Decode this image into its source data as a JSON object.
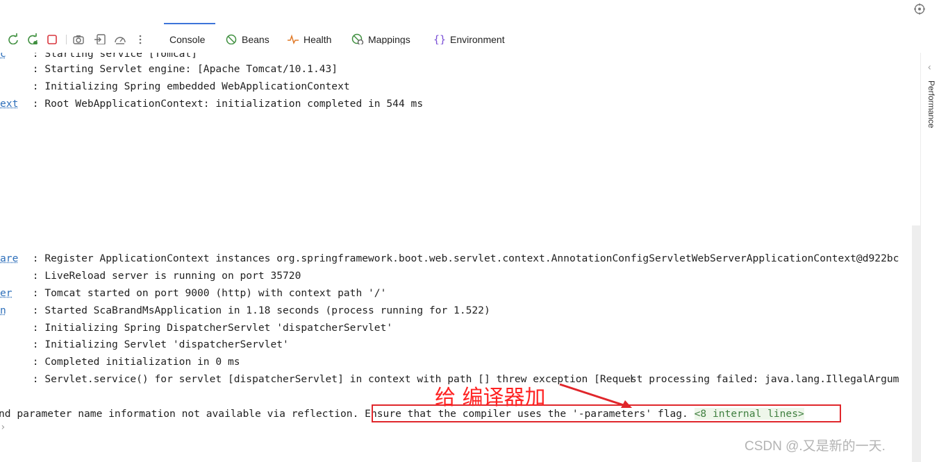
{
  "toolbar": {
    "icons": [
      "restart-icon",
      "restart-debug-icon",
      "stop-icon",
      "screenshot-icon",
      "exit-icon",
      "dashboard-icon",
      "more-icon"
    ],
    "tabs": [
      {
        "label": "Console",
        "icon": "console",
        "active": true
      },
      {
        "label": "Beans",
        "icon": "beans-icon"
      },
      {
        "label": "Health",
        "icon": "health-icon"
      },
      {
        "label": "Mappings",
        "icon": "mappings-icon"
      },
      {
        "label": "Environment",
        "icon": "environment-icon"
      }
    ]
  },
  "side_panel": {
    "label": "Performance"
  },
  "console": {
    "lines": [
      {
        "prefix": "c",
        "text": " : Starting service [Tomcat]"
      },
      {
        "prefix": "",
        "text": " : Starting Servlet engine: [Apache Tomcat/10.1.43]"
      },
      {
        "prefix": "",
        "text": " : Initializing Spring embedded WebApplicationContext"
      },
      {
        "prefix": "ext",
        "text": " : Root WebApplicationContext: initialization completed in 544 ms"
      },
      {
        "prefix": "are",
        "text": " : Register ApplicationContext instances org.springframework.boot.web.servlet.context.AnnotationConfigServletWebServerApplicationContext@d922bc"
      },
      {
        "prefix": "",
        "text": " : LiveReload server is running on port 35720"
      },
      {
        "prefix": "er",
        "text": " : Tomcat started on port 9000 (http) with context path '/'"
      },
      {
        "prefix": "n",
        "text": " : Started ScaBrandMsApplication in 1.18 seconds (process running for 1.522)"
      },
      {
        "prefix": "",
        "text": " : Initializing Spring DispatcherServlet 'dispatcherServlet'"
      },
      {
        "prefix": "",
        "text": " : Initializing Servlet 'dispatcherServlet'"
      },
      {
        "prefix": "",
        "text": " : Completed initialization in 0 ms"
      },
      {
        "prefix": "",
        "text": " : Servlet.service() for servlet [dispatcherServlet] in context with path [] threw exception [Request processing failed: java.lang.IllegalArgum"
      }
    ],
    "error_line": {
      "prefix_text": "nd parameter name information not available via reflection. ",
      "highlight": "Ensure that the compiler uses the '-parameters' flag.",
      "internal": "<8 internal lines>"
    }
  },
  "annotation": {
    "text": "给 编译器加",
    "color": "#e0262b"
  },
  "watermark": "CSDN @.又是新的一天.",
  "colors": {
    "link": "#2e6fba",
    "internal_bg": "#eef6ea",
    "annotation": "#e0262b"
  }
}
